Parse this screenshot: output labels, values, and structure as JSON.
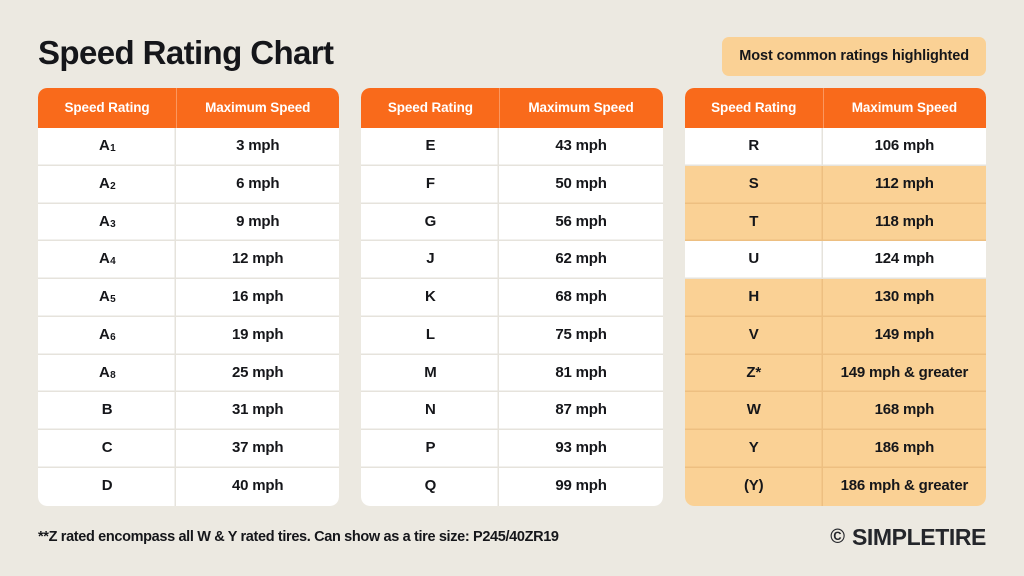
{
  "header": {
    "title": "Speed Rating Chart",
    "legend_badge": "Most common ratings highlighted"
  },
  "colors": {
    "background": "#ECE9E1",
    "header_orange": "#F96A1B",
    "highlight": "#FAD195",
    "row_white": "#FFFFFF",
    "text": "#15161A"
  },
  "columns": {
    "rating": "Speed Rating",
    "speed": "Maximum Speed"
  },
  "tables": [
    {
      "id": "table-1",
      "rows": [
        {
          "rating": "A",
          "sub": "1",
          "speed": "3 mph",
          "highlighted": false
        },
        {
          "rating": "A",
          "sub": "2",
          "speed": "6 mph",
          "highlighted": false
        },
        {
          "rating": "A",
          "sub": "3",
          "speed": "9 mph",
          "highlighted": false
        },
        {
          "rating": "A",
          "sub": "4",
          "speed": "12 mph",
          "highlighted": false
        },
        {
          "rating": "A",
          "sub": "5",
          "speed": "16 mph",
          "highlighted": false
        },
        {
          "rating": "A",
          "sub": "6",
          "speed": "19 mph",
          "highlighted": false
        },
        {
          "rating": "A",
          "sub": "8",
          "speed": "25 mph",
          "highlighted": false
        },
        {
          "rating": "B",
          "sub": "",
          "speed": "31 mph",
          "highlighted": false
        },
        {
          "rating": "C",
          "sub": "",
          "speed": "37 mph",
          "highlighted": false
        },
        {
          "rating": "D",
          "sub": "",
          "speed": "40 mph",
          "highlighted": false
        }
      ]
    },
    {
      "id": "table-2",
      "rows": [
        {
          "rating": "E",
          "sub": "",
          "speed": "43 mph",
          "highlighted": false
        },
        {
          "rating": "F",
          "sub": "",
          "speed": "50 mph",
          "highlighted": false
        },
        {
          "rating": "G",
          "sub": "",
          "speed": "56 mph",
          "highlighted": false
        },
        {
          "rating": "J",
          "sub": "",
          "speed": "62 mph",
          "highlighted": false
        },
        {
          "rating": "K",
          "sub": "",
          "speed": "68 mph",
          "highlighted": false
        },
        {
          "rating": "L",
          "sub": "",
          "speed": "75 mph",
          "highlighted": false
        },
        {
          "rating": "M",
          "sub": "",
          "speed": "81 mph",
          "highlighted": false
        },
        {
          "rating": "N",
          "sub": "",
          "speed": "87 mph",
          "highlighted": false
        },
        {
          "rating": "P",
          "sub": "",
          "speed": "93 mph",
          "highlighted": false
        },
        {
          "rating": "Q",
          "sub": "",
          "speed": "99 mph",
          "highlighted": false
        }
      ]
    },
    {
      "id": "table-3",
      "rows": [
        {
          "rating": "R",
          "sub": "",
          "speed": "106 mph",
          "highlighted": false
        },
        {
          "rating": "S",
          "sub": "",
          "speed": "112 mph",
          "highlighted": true
        },
        {
          "rating": "T",
          "sub": "",
          "speed": "118 mph",
          "highlighted": true
        },
        {
          "rating": "U",
          "sub": "",
          "speed": "124 mph",
          "highlighted": false
        },
        {
          "rating": "H",
          "sub": "",
          "speed": "130 mph",
          "highlighted": true
        },
        {
          "rating": "V",
          "sub": "",
          "speed": "149 mph",
          "highlighted": true
        },
        {
          "rating": "Z*",
          "sub": "",
          "speed": "149 mph & greater",
          "highlighted": true
        },
        {
          "rating": "W",
          "sub": "",
          "speed": "168 mph",
          "highlighted": true
        },
        {
          "rating": "Y",
          "sub": "",
          "speed": "186 mph",
          "highlighted": true
        },
        {
          "rating": "(Y)",
          "sub": "",
          "speed": "186 mph & greater",
          "highlighted": true
        }
      ]
    }
  ],
  "footer": {
    "note": "**Z rated encompass all W & Y rated tires.  Can show as a tire size: P245/40ZR19",
    "brand_mark": "©",
    "brand_name": "SIMPLETIRE"
  }
}
